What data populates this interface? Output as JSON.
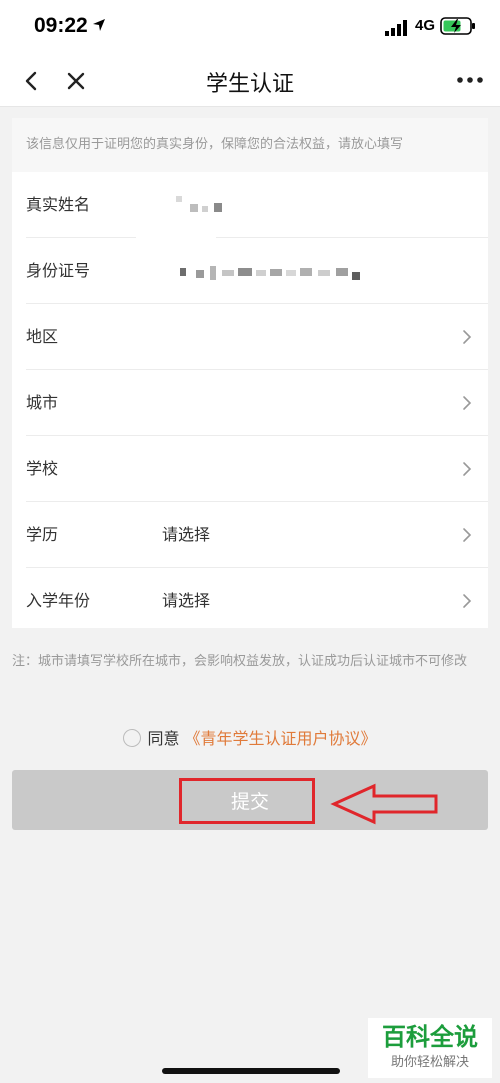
{
  "status_bar": {
    "time": "09:22",
    "network": "4G"
  },
  "nav": {
    "title": "学生认证"
  },
  "form": {
    "hint": "该信息仅用于证明您的真实身份，保障您的合法权益，请放心填写",
    "rows": [
      {
        "label": "真实姓名",
        "value": ""
      },
      {
        "label": "身份证号",
        "value": ""
      },
      {
        "label": "地区",
        "value": ""
      },
      {
        "label": "城市",
        "value": ""
      },
      {
        "label": "学校",
        "value": ""
      },
      {
        "label": "学历",
        "value": "请选择"
      },
      {
        "label": "入学年份",
        "value": "请选择"
      }
    ]
  },
  "note": "注：城市请填写学校所在城市，会影响权益发放，认证成功后认证城市不可修改",
  "agreement": {
    "prefix": "同意",
    "link": "《青年学生认证用户协议》"
  },
  "submit": {
    "label": "提交"
  },
  "watermark": {
    "title": "百科全说",
    "subtitle": "助你轻松解决"
  },
  "colors": {
    "accent_link": "#e07a3a",
    "annotation": "#e0262b",
    "button_disabled": "#c9c9c9",
    "watermark": "#1c9d3c"
  },
  "icons": [
    "location-arrow-icon",
    "signal-icon",
    "battery-charging-icon",
    "back-icon",
    "close-icon",
    "more-icon",
    "chevron-right-icon"
  ]
}
